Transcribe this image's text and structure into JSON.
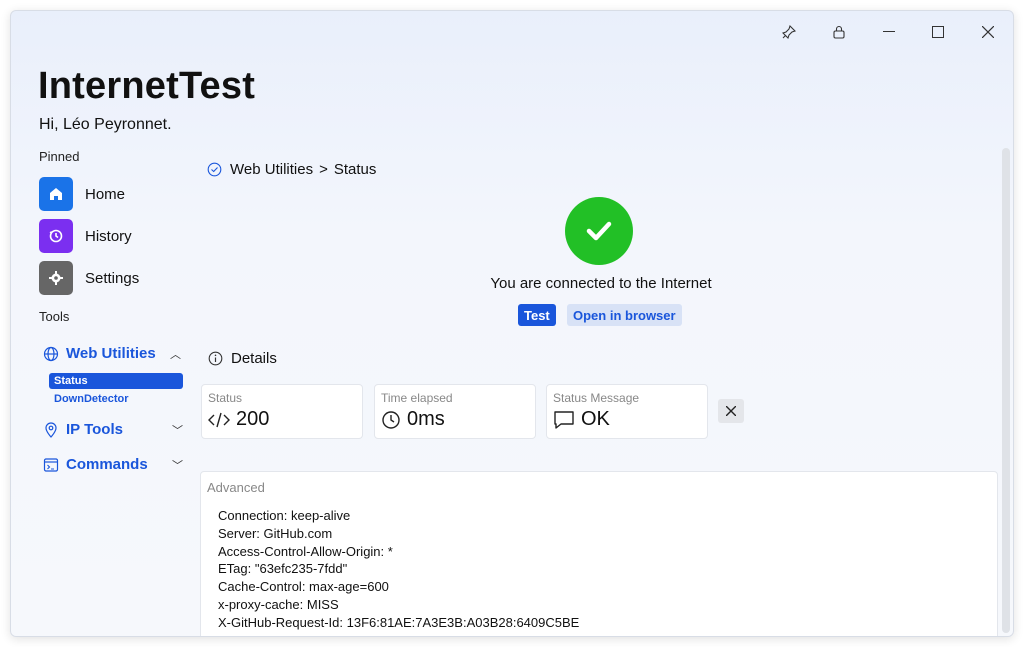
{
  "app": {
    "title": "InternetTest",
    "greeting": "Hi, Léo Peyronnet."
  },
  "titlebar": {
    "pin_icon": "pin-icon",
    "lock_icon": "lock-icon",
    "minimize": "—",
    "maximize": "☐",
    "close": "✕"
  },
  "sidebar": {
    "pinned_label": "Pinned",
    "pinned": [
      {
        "label": "Home",
        "icon": "home-icon",
        "color": "#1a73e8"
      },
      {
        "label": "History",
        "icon": "history-icon",
        "color": "#7b2ff0"
      },
      {
        "label": "Settings",
        "icon": "gear-icon",
        "color": "#666666"
      }
    ],
    "tools_label": "Tools",
    "groups": [
      {
        "label": "Web Utilities",
        "icon": "globe-icon",
        "expanded": true,
        "items": [
          {
            "label": "Status",
            "active": true
          },
          {
            "label": "DownDetector",
            "active": false
          }
        ]
      },
      {
        "label": "IP Tools",
        "icon": "location-icon",
        "expanded": false
      },
      {
        "label": "Commands",
        "icon": "terminal-icon",
        "expanded": false
      }
    ]
  },
  "breadcrumb": {
    "parent": "Web Utilities",
    "separator": ">",
    "current": "Status"
  },
  "status": {
    "message": "You are connected to the Internet",
    "test_label": "Test",
    "open_label": "Open in browser",
    "color": "#22c026"
  },
  "details": {
    "title": "Details",
    "cards": [
      {
        "label": "Status",
        "value": "200",
        "icon": "code-icon"
      },
      {
        "label": "Time elapsed",
        "value": "0ms",
        "icon": "clock-icon"
      },
      {
        "label": "Status Message",
        "value": "OK",
        "icon": "message-icon"
      }
    ]
  },
  "advanced": {
    "label": "Advanced",
    "headers": [
      "Connection: keep-alive",
      "Server: GitHub.com",
      "Access-Control-Allow-Origin: *",
      "ETag: \"63efc235-7fdd\"",
      "Cache-Control: max-age=600",
      "x-proxy-cache: MISS",
      "X-GitHub-Request-Id: 13F6:81AE:7A3E3B:A03B28:6409C5BE"
    ]
  },
  "colors": {
    "accent": "#1a56db",
    "success": "#22c026"
  }
}
